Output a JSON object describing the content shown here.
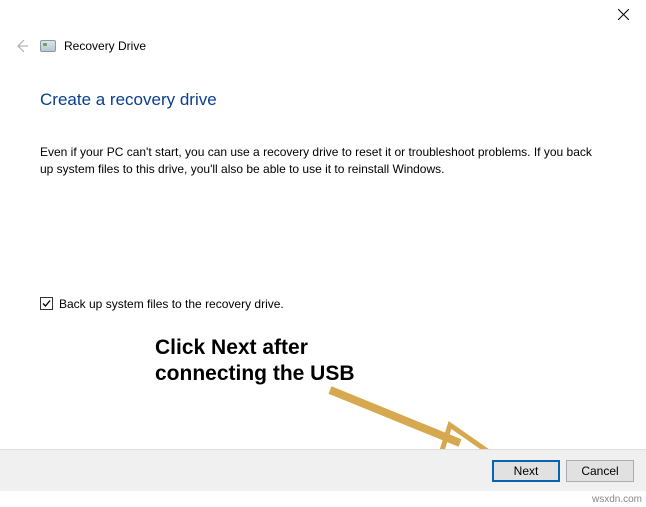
{
  "window": {
    "title": "Recovery Drive"
  },
  "page": {
    "heading": "Create a recovery drive",
    "description": "Even if your PC can't start, you can use a recovery drive to reset it or troubleshoot problems. If you back up system files to this drive, you'll also be able to use it to reinstall Windows."
  },
  "checkbox": {
    "label": "Back up system files to the recovery drive.",
    "checked": true
  },
  "buttons": {
    "next": "Next",
    "cancel": "Cancel"
  },
  "annotation": {
    "line1": "Click Next after",
    "line2": "connecting the USB"
  },
  "watermark": "wsxdn.com"
}
